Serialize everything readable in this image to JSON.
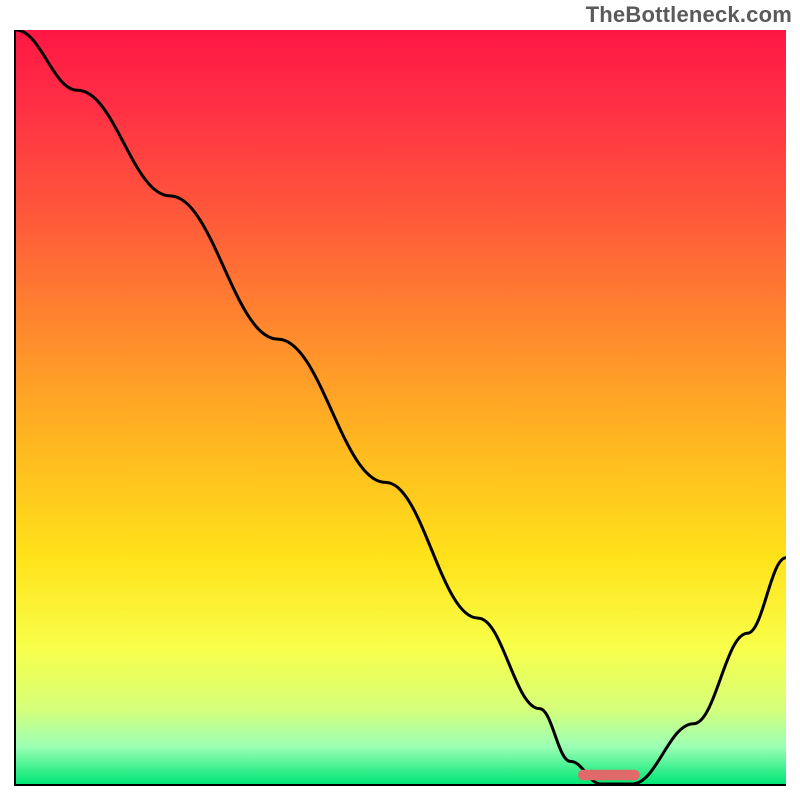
{
  "watermark": "TheBottleneck.com",
  "chart_data": {
    "type": "line",
    "title": "",
    "xlabel": "",
    "ylabel": "",
    "xlim": [
      0,
      100
    ],
    "ylim": [
      0,
      100
    ],
    "grid": false,
    "legend": false,
    "gradient_stops": [
      {
        "offset": 0.0,
        "color": "#ff1744"
      },
      {
        "offset": 0.1,
        "color": "#ff2f45"
      },
      {
        "offset": 0.25,
        "color": "#ff5a3a"
      },
      {
        "offset": 0.4,
        "color": "#ff8a2d"
      },
      {
        "offset": 0.55,
        "color": "#ffb820"
      },
      {
        "offset": 0.7,
        "color": "#ffe21a"
      },
      {
        "offset": 0.82,
        "color": "#f8ff4a"
      },
      {
        "offset": 0.9,
        "color": "#d6ff7a"
      },
      {
        "offset": 0.95,
        "color": "#9cffb4"
      },
      {
        "offset": 1.0,
        "color": "#00e676"
      }
    ],
    "series": [
      {
        "name": "bottleneck-curve",
        "color": "#000000",
        "x": [
          0,
          8,
          20,
          34,
          48,
          60,
          68,
          72,
          76,
          80,
          88,
          95,
          100
        ],
        "y": [
          100,
          92,
          78,
          59,
          40,
          22,
          10,
          3,
          0,
          0,
          8,
          20,
          30
        ]
      }
    ],
    "marker": {
      "name": "optimal-range",
      "shape": "rounded-bar",
      "color": "#e06a6a",
      "x_start": 73,
      "x_end": 81,
      "y": 1.2,
      "thickness_pct": 1.4
    }
  }
}
